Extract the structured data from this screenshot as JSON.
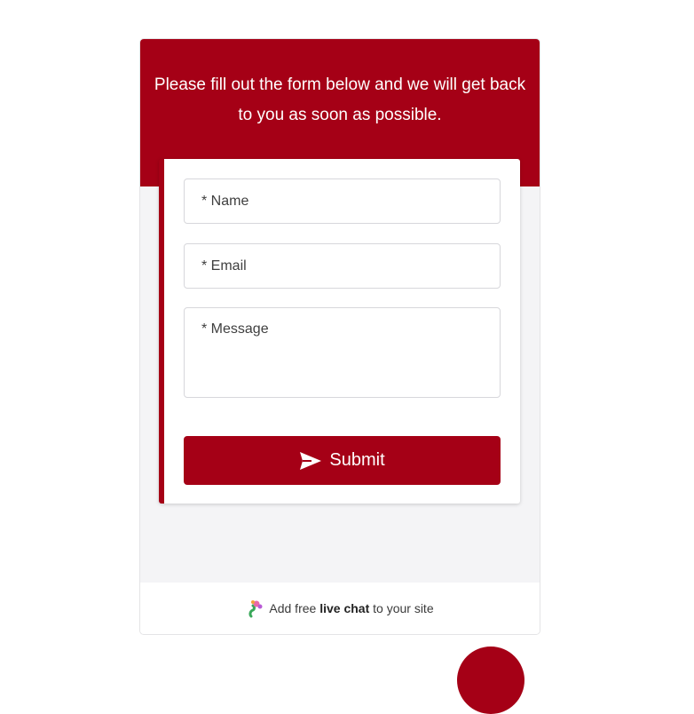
{
  "header": {
    "message": "Please fill out the form below and we will get back to you as soon as possible."
  },
  "form": {
    "name_placeholder": "* Name",
    "email_placeholder": "* Email",
    "message_placeholder": "* Message",
    "submit_label": "Submit"
  },
  "footer": {
    "prefix": "Add free",
    "bold": "live chat",
    "suffix": "to your site"
  },
  "colors": {
    "accent": "#a50016",
    "panel_bg": "#f4f4f6"
  },
  "icons": {
    "submit": "send-icon",
    "footer": "livechat-logo-icon"
  }
}
